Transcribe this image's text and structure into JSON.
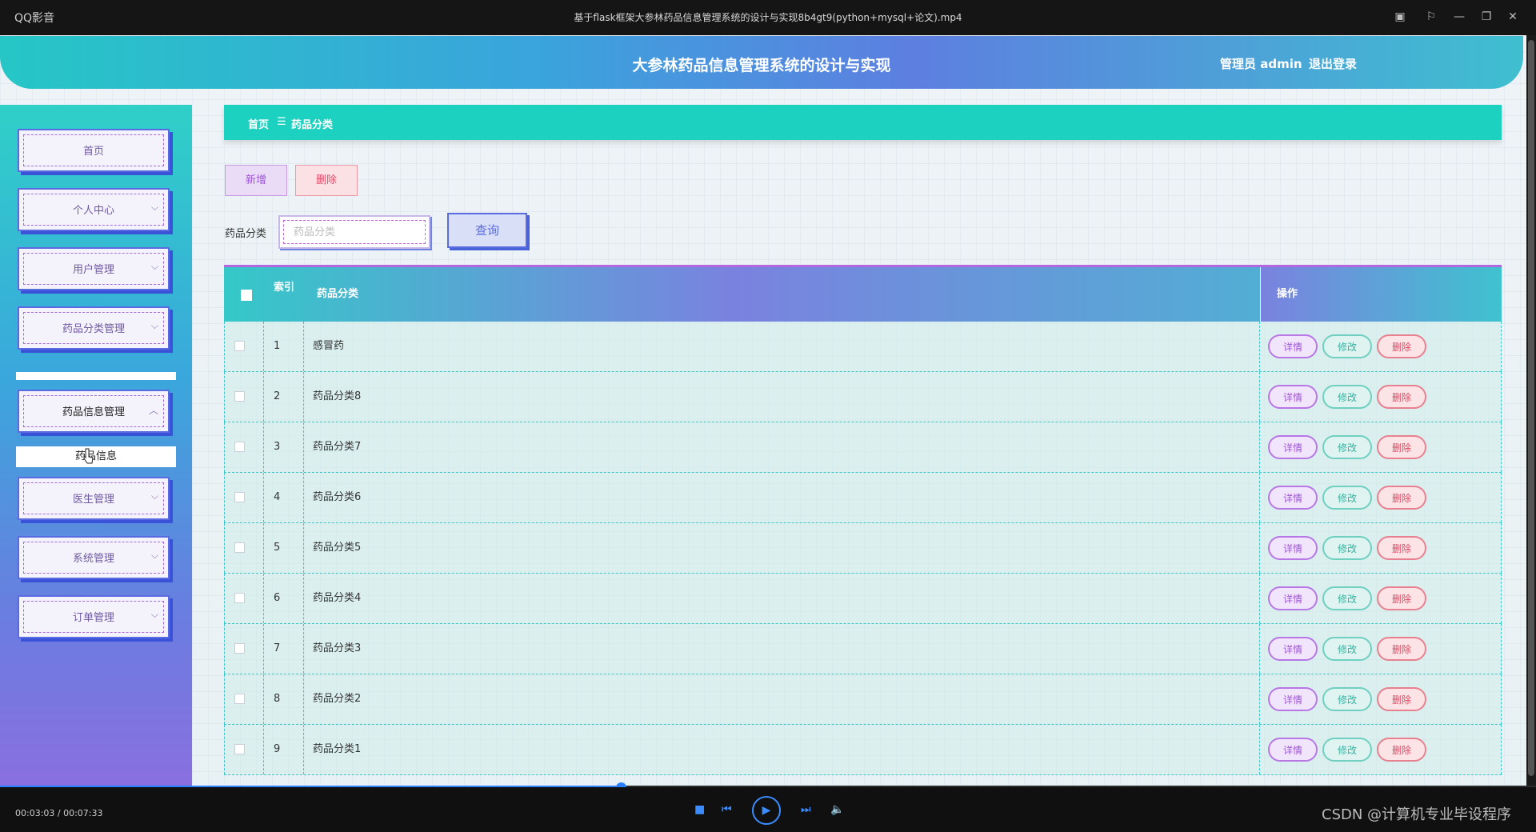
{
  "player": {
    "brand": "QQ影音",
    "file_title": "基于flask框架大参林药品信息管理系统的设计与实现8b4gt9(python+mysql+论文).mp4",
    "time": "00:03:03 / 00:07:33",
    "progress": 0.404,
    "watermark": "CSDN @计算机专业毕设程序"
  },
  "header": {
    "title": "大参林药品信息管理系统的设计与实现",
    "user": "管理员 admin",
    "logout": "退出登录"
  },
  "sidebar": {
    "items": [
      {
        "label": "首页"
      },
      {
        "label": "个人中心"
      },
      {
        "label": "用户管理"
      },
      {
        "label": "药品分类管理"
      },
      {
        "label": "药品信息管理"
      },
      {
        "label": "医生管理"
      },
      {
        "label": "系统管理"
      },
      {
        "label": "订单管理"
      }
    ],
    "submenu": {
      "label": "药品信息"
    }
  },
  "breadcrumb": {
    "home": "首页",
    "separator": "☰",
    "current": "药品分类"
  },
  "toolbar": {
    "add": "新增",
    "delete": "删除"
  },
  "search": {
    "label": "药品分类",
    "placeholder": "药品分类",
    "button": "查询"
  },
  "table": {
    "columns": {
      "index": "索引",
      "name": "药品分类",
      "op": "操作"
    },
    "actions": {
      "detail": "详情",
      "edit": "修改",
      "delete": "删除"
    },
    "rows": [
      {
        "index": "1",
        "name": "感冒药"
      },
      {
        "index": "2",
        "name": "药品分类8"
      },
      {
        "index": "3",
        "name": "药品分类7"
      },
      {
        "index": "4",
        "name": "药品分类6"
      },
      {
        "index": "5",
        "name": "药品分类5"
      },
      {
        "index": "6",
        "name": "药品分类4"
      },
      {
        "index": "7",
        "name": "药品分类3"
      },
      {
        "index": "8",
        "name": "药品分类2"
      },
      {
        "index": "9",
        "name": "药品分类1"
      }
    ]
  }
}
